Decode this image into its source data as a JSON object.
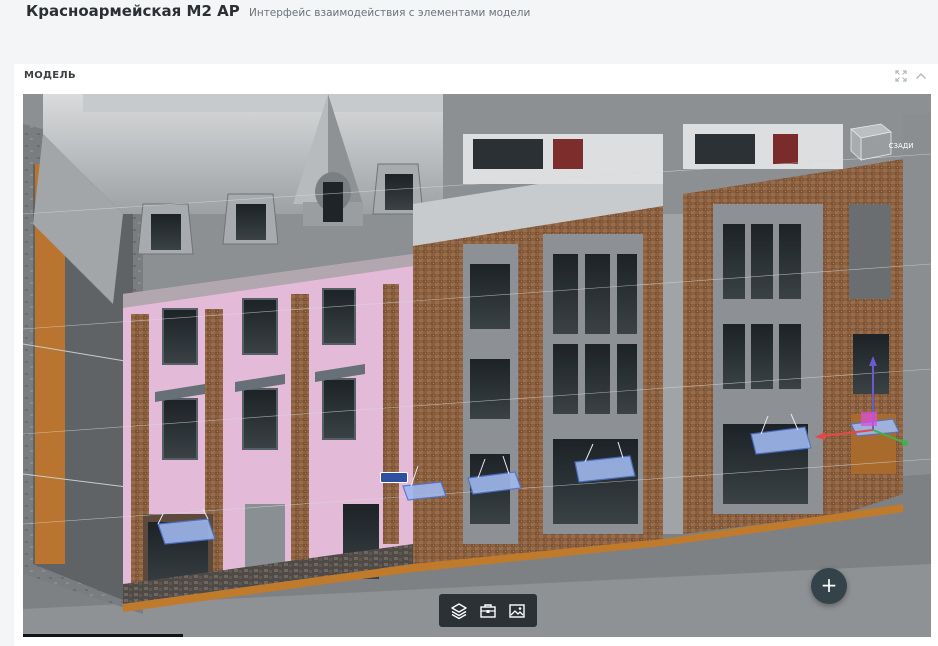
{
  "header": {
    "title": "Красноармейская М2 АР",
    "subtitle": "Интерфейс взаимодействия с элементами модели"
  },
  "panel": {
    "label": "МОДЕЛЬ",
    "tools": {
      "expand_icon": "expand-icon",
      "collapse_icon": "chevron-up-icon"
    }
  },
  "viewer": {
    "viewcube_label": "СЗАДИ",
    "fab_label": "+",
    "toolbar": [
      {
        "name": "layers-button",
        "icon": "layers-icon"
      },
      {
        "name": "toolbox-button",
        "icon": "toolbox-icon"
      },
      {
        "name": "image-button",
        "icon": "image-icon"
      }
    ]
  },
  "colors": {
    "accent_dark": "#34424a",
    "toolbar_bg": "#2c3136",
    "facade_pink": "#e2b9d8",
    "facade_brick": "#8a5e3a",
    "selection_blue": "#7fa2e6"
  }
}
